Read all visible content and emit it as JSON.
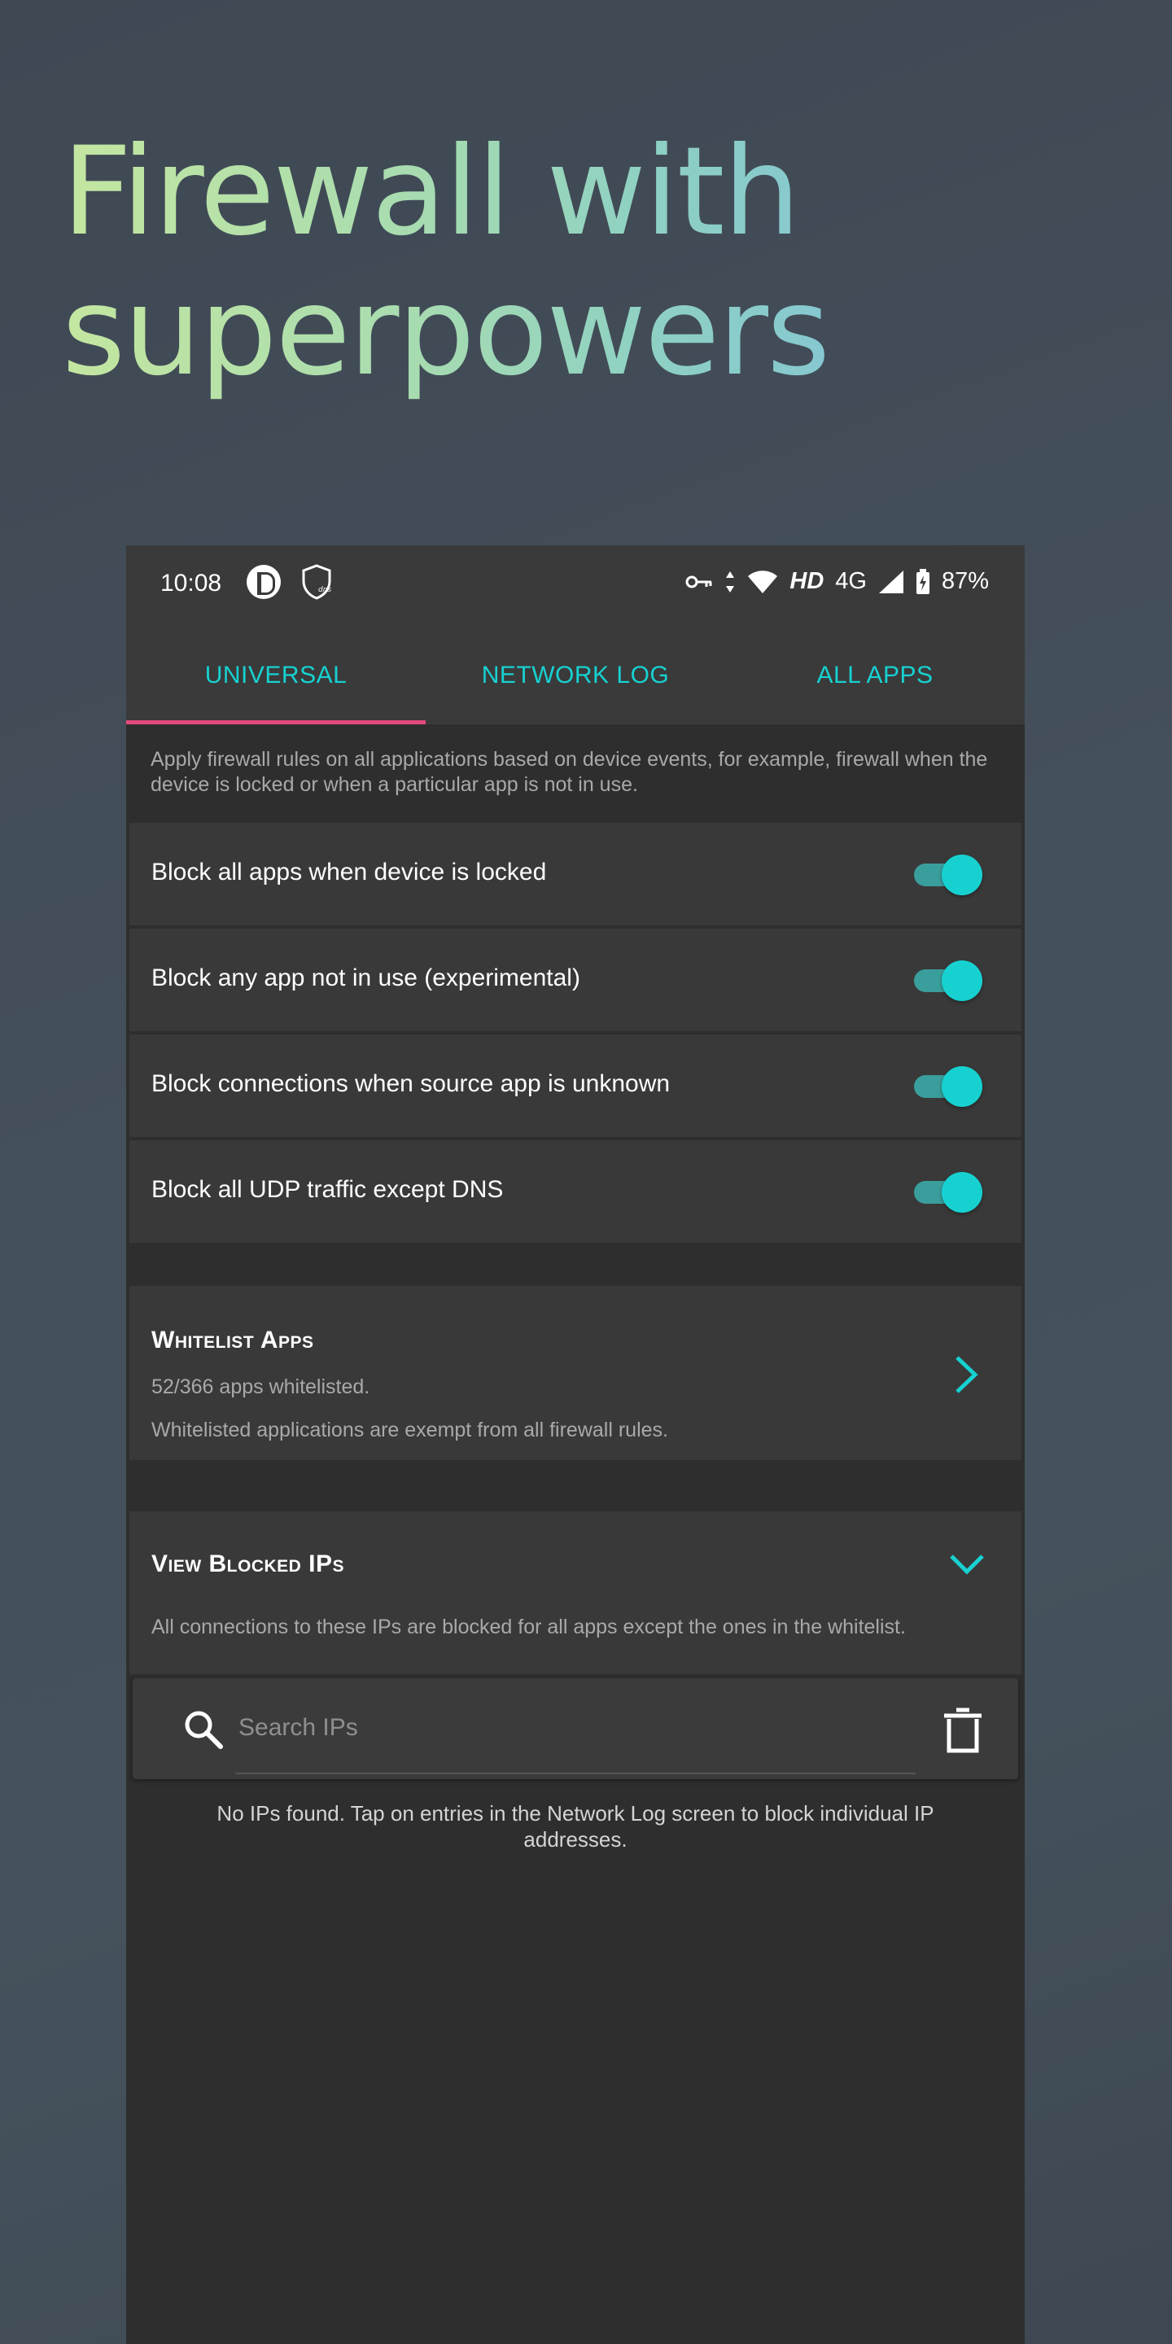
{
  "headline": {
    "line1": "Firewall with",
    "line2": "superpowers"
  },
  "status_bar": {
    "time": "10:08",
    "network_hd": "HD",
    "network_type": "4G",
    "battery": "87%",
    "icons": [
      "app-notification-icon",
      "shield-dns-icon",
      "vpn-key-icon",
      "data-arrows-icon",
      "wifi-icon",
      "signal-icon",
      "battery-charging-icon"
    ]
  },
  "tabs": [
    {
      "label": "UNIVERSAL",
      "active": true
    },
    {
      "label": "NETWORK LOG",
      "active": false
    },
    {
      "label": "ALL APPS",
      "active": false
    }
  ],
  "intro_text": "Apply firewall rules on all applications based on device events, for example, firewall when the device is locked or when a particular app is not in use.",
  "toggles": [
    {
      "label": "Block all apps when device is locked",
      "enabled": true
    },
    {
      "label": "Block any app not in use (experimental)",
      "enabled": true
    },
    {
      "label": "Block connections when source app is unknown",
      "enabled": true
    },
    {
      "label": "Block all UDP traffic except DNS",
      "enabled": true
    }
  ],
  "whitelist": {
    "title": "Whitelist Apps",
    "count": "52/366 apps whitelisted.",
    "description": "Whitelisted applications are exempt from all firewall rules."
  },
  "blocked_ips": {
    "title": "View Blocked IPs",
    "description": "All connections to these IPs are blocked for all apps except the ones in the whitelist.",
    "search_placeholder": "Search IPs",
    "empty_message": "No IPs found. Tap on entries in the Network Log screen to block individual IP addresses."
  },
  "colors": {
    "accent": "#17d1d1",
    "tab_indicator": "#e34a7c",
    "surface": "#393939",
    "background": "#2e2e2e"
  }
}
